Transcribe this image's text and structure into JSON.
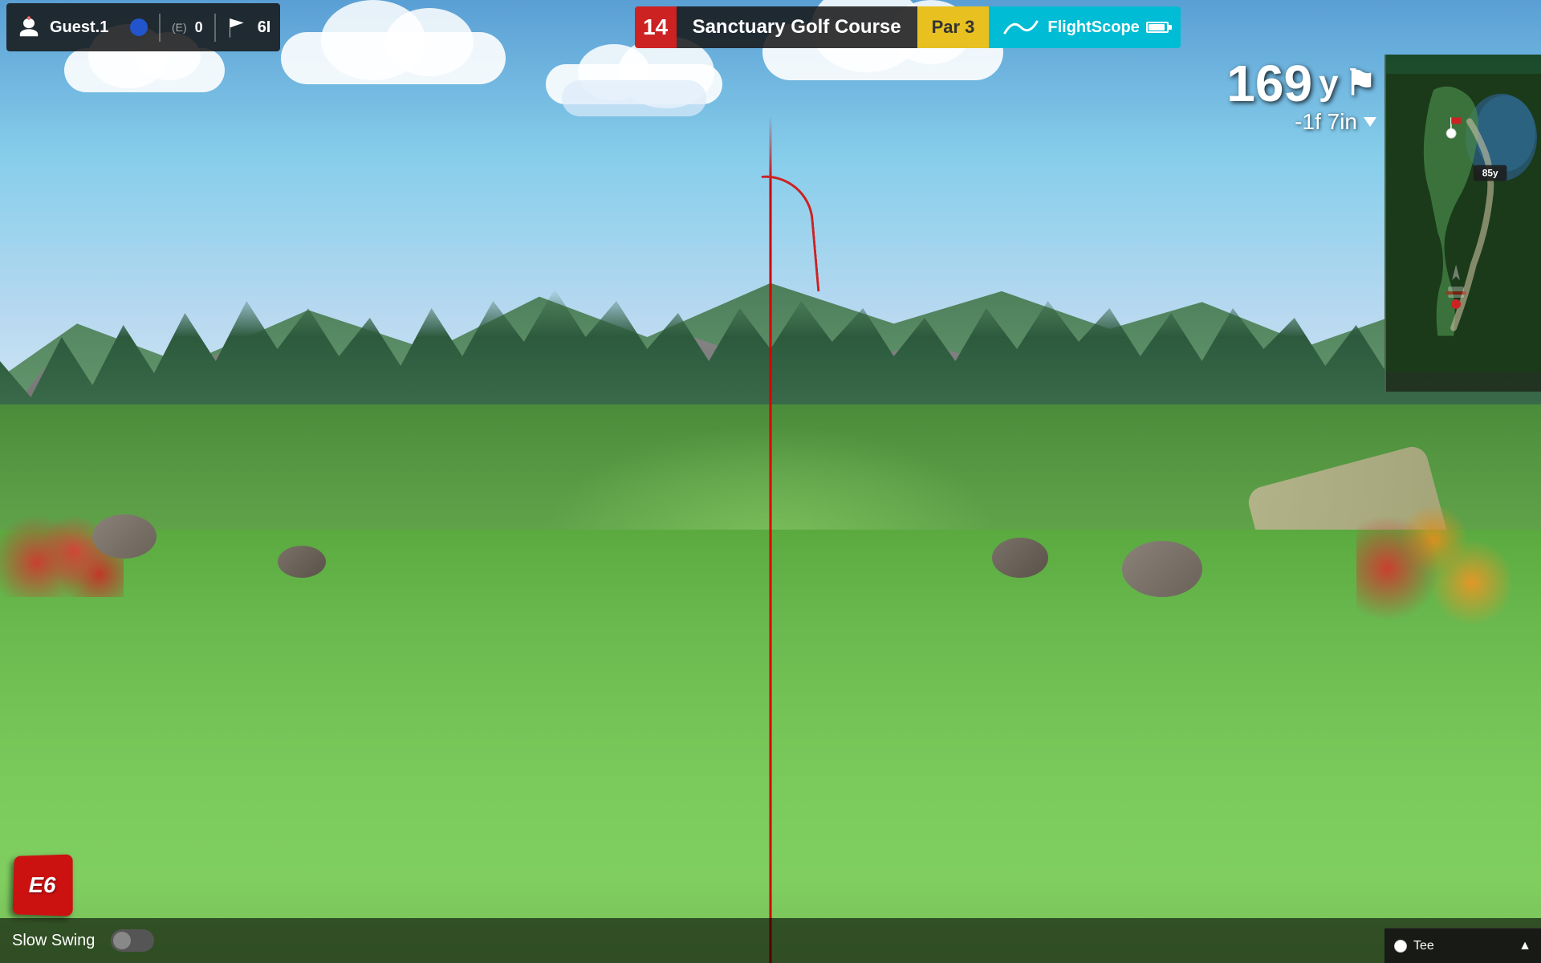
{
  "header": {
    "player": {
      "name": "Guest.1",
      "icon": "player-icon",
      "score_bubble_color": "#2255cc",
      "event_label": "(E)",
      "event_score": "0",
      "club": "6I"
    },
    "hole": {
      "number": "14",
      "course_name": "Sanctuary Golf Course",
      "par_label": "Par",
      "par_value": "3"
    },
    "flightscope": {
      "label": "FlightScope"
    }
  },
  "hud": {
    "distance_yards": "169",
    "distance_unit": "y",
    "flag_icon": "⛳",
    "secondary_distance": "-1f 7in",
    "down_arrow": true
  },
  "minimap": {
    "distance_label": "85y",
    "tee_label": "Tee",
    "expand_tooltip": "expand"
  },
  "bottom_bar": {
    "slow_swing_label": "Slow Swing",
    "toggle_state": "off"
  },
  "e6_logo": {
    "text": "E6"
  },
  "colors": {
    "hole_badge_bg": "#cc2222",
    "par_badge_bg": "#e8c020",
    "flightscope_bg": "#00bcd4",
    "aim_line": "#cc0000",
    "sky_top": "#5a9fd4",
    "sky_bottom": "#d4e8f5"
  }
}
